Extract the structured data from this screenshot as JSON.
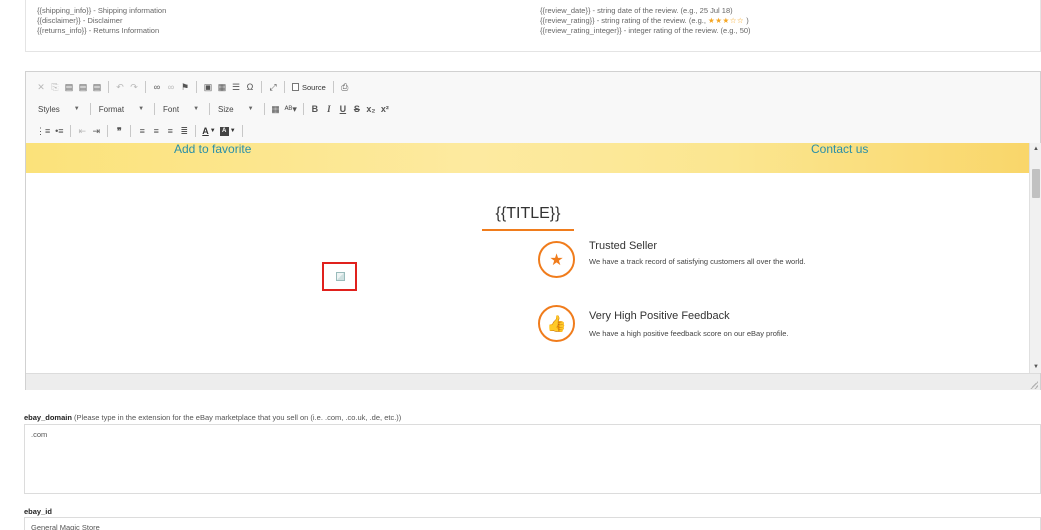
{
  "placeholders": {
    "left": [
      "{{shipping_info}} - Shipping information",
      "{{disclaimer}} - Disclaimer",
      "{{returns_info}} - Returns Information"
    ],
    "right": {
      "date": "{{review_date}} - string date of the review. (e.g., 25 Jul 18)",
      "rating_prefix": "{{review_rating}} - string rating of the review. (e.g.,",
      "rating_stars": "★★★☆☆",
      "rating_suffix": ")",
      "rating_integer": "{{review_rating_integer}} - integer rating of the review. (e.g., 50)"
    }
  },
  "toolbar": {
    "source_label": "Source",
    "styles_label": "Styles",
    "format_label": "Format",
    "font_label": "Font",
    "size_label": "Size"
  },
  "content": {
    "add_favorite": "Add to favorite",
    "contact_us": "Contact us",
    "title": "{{TITLE}}",
    "features": [
      {
        "title": "Trusted Seller",
        "desc": "We have a track record of satisfying customers all over the world.",
        "icon": "star-icon"
      },
      {
        "title": "Very High Positive Feedback",
        "desc": "We have a high positive feedback score on our eBay profile.",
        "icon": "thumbs-up-icon"
      }
    ]
  },
  "fields": {
    "ebay_domain": {
      "name": "ebay_domain",
      "hint": "(Please type in the extension for the eBay marketplace that you sell on (i.e. .com, .co.uk, .de, etc.))",
      "value": ".com"
    },
    "ebay_id": {
      "name": "ebay_id",
      "value": "General Magic Store"
    }
  },
  "colors": {
    "accent": "#f07c1c",
    "link": "#2a8fa8",
    "highlight": "#e0211d"
  }
}
